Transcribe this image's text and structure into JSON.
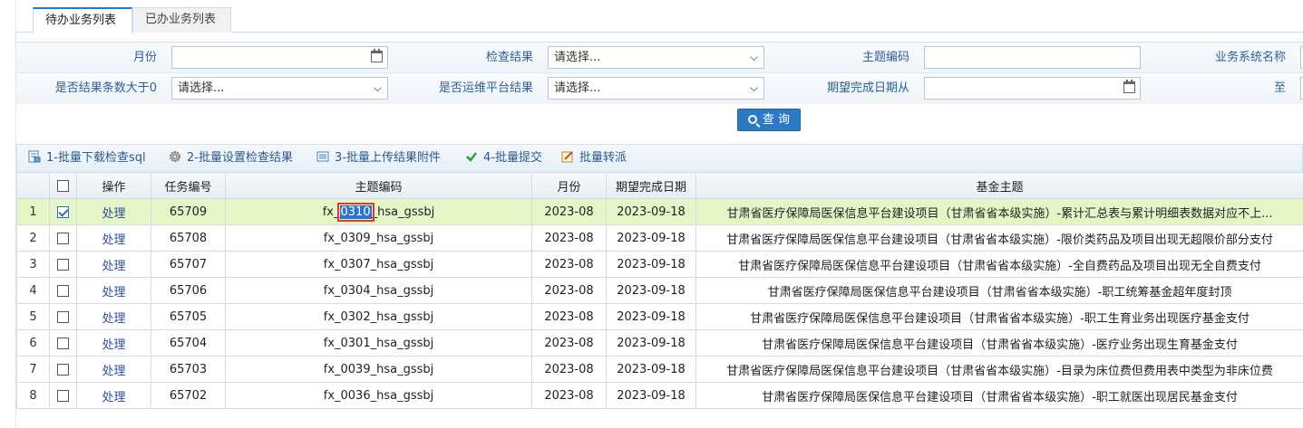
{
  "tabs": [
    {
      "label": "待办业务列表",
      "active": true
    },
    {
      "label": "已办业务列表",
      "active": false
    }
  ],
  "form": {
    "row1": {
      "month_label": "月份",
      "month_value": "",
      "check_result_label": "检查结果",
      "check_result_value": "请选择...",
      "topic_code_label": "主题编码",
      "topic_code_value": "",
      "biz_system_label": "业务系统名称"
    },
    "row2": {
      "count_gt0_label": "是否结果条数大于0",
      "count_gt0_value": "请选择...",
      "ops_platform_label": "是否运维平台结果",
      "ops_platform_value": "请选择...",
      "expected_from_label": "期望完成日期从",
      "expected_from_value": "",
      "to_label": "至"
    },
    "search_button": "查 询"
  },
  "toolbar": [
    {
      "label": "1-批量下载检查sql",
      "icon": "download-icon"
    },
    {
      "label": "2-批量设置检查结果",
      "icon": "gear-icon"
    },
    {
      "label": "3-批量上传结果附件",
      "icon": "upload-icon"
    },
    {
      "label": "4-批量提交",
      "icon": "check-icon"
    },
    {
      "label": "批量转派",
      "icon": "transfer-icon"
    }
  ],
  "grid": {
    "columns": [
      "",
      "",
      "操作",
      "任务编号",
      "主题编码",
      "月份",
      "期望完成日期",
      "基金主题"
    ],
    "rows": [
      {
        "no": "1",
        "checked": true,
        "op": "处理",
        "task": "65709",
        "code_pre": "fx_",
        "code_hl": "0310",
        "code_post": "_hsa_gssbj",
        "month": "2023-08",
        "date": "2023-09-18",
        "topic": "甘肃省医疗保障局医保信息平台建设项目（甘肃省省本级实施）-累计汇总表与累计明细表数据对应不上..."
      },
      {
        "no": "2",
        "checked": false,
        "op": "处理",
        "task": "65708",
        "code": "fx_0309_hsa_gssbj",
        "month": "2023-08",
        "date": "2023-09-18",
        "topic": "甘肃省医疗保障局医保信息平台建设项目（甘肃省省本级实施）-限价类药品及项目出现无超限价部分支付"
      },
      {
        "no": "3",
        "checked": false,
        "op": "处理",
        "task": "65707",
        "code": "fx_0307_hsa_gssbj",
        "month": "2023-08",
        "date": "2023-09-18",
        "topic": "甘肃省医疗保障局医保信息平台建设项目（甘肃省省本级实施）-全自费药品及项目出现无全自费支付"
      },
      {
        "no": "4",
        "checked": false,
        "op": "处理",
        "task": "65706",
        "code": "fx_0304_hsa_gssbj",
        "month": "2023-08",
        "date": "2023-09-18",
        "topic": "甘肃省医疗保障局医保信息平台建设项目（甘肃省省本级实施）-职工统筹基金超年度封顶"
      },
      {
        "no": "5",
        "checked": false,
        "op": "处理",
        "task": "65705",
        "code": "fx_0302_hsa_gssbj",
        "month": "2023-08",
        "date": "2023-09-18",
        "topic": "甘肃省医疗保障局医保信息平台建设项目（甘肃省省本级实施）-职工生育业务出现医疗基金支付"
      },
      {
        "no": "6",
        "checked": false,
        "op": "处理",
        "task": "65704",
        "code": "fx_0301_hsa_gssbj",
        "month": "2023-08",
        "date": "2023-09-18",
        "topic": "甘肃省医疗保障局医保信息平台建设项目（甘肃省省本级实施）-医疗业务出现生育基金支付"
      },
      {
        "no": "7",
        "checked": false,
        "op": "处理",
        "task": "65703",
        "code": "fx_0039_hsa_gssbj",
        "month": "2023-08",
        "date": "2023-09-18",
        "topic": "甘肃省医疗保障局医保信息平台建设项目（甘肃省省本级实施）-目录为床位费但费用表中类型为非床位费"
      },
      {
        "no": "8",
        "checked": false,
        "op": "处理",
        "task": "65702",
        "code": "fx_0036_hsa_gssbj",
        "month": "2023-08",
        "date": "2023-09-18",
        "topic": "甘肃省医疗保障局医保信息平台建设项目（甘肃省省本级实施）-职工就医出现居民基金支付"
      }
    ]
  }
}
